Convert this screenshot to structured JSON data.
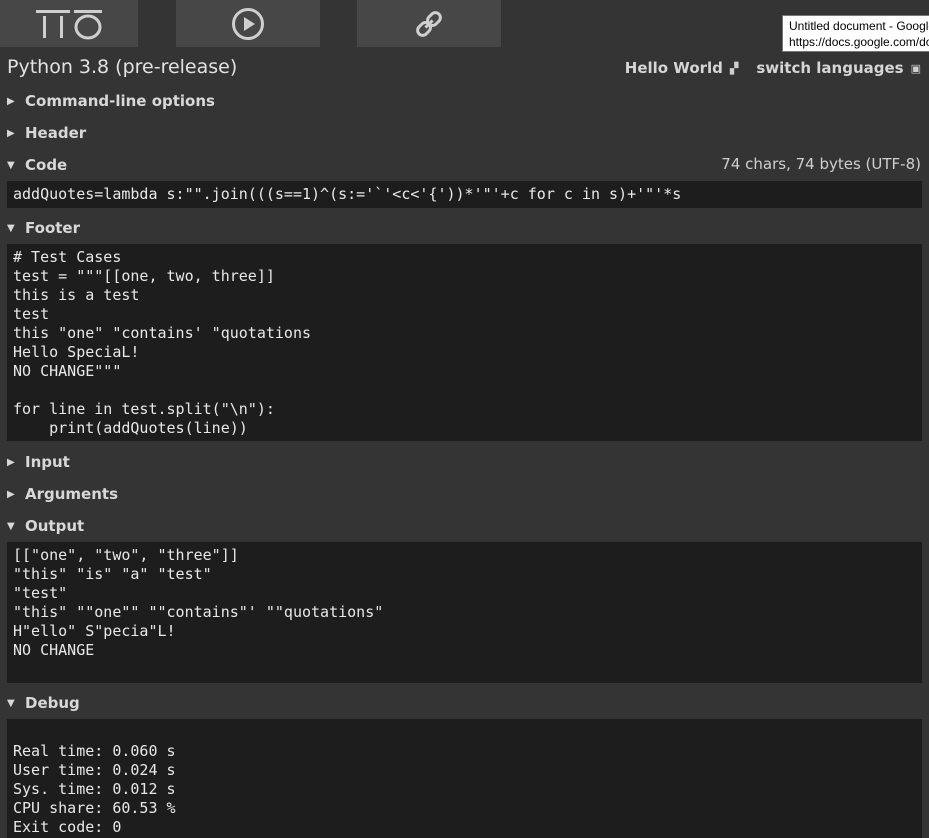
{
  "topbar": {
    "logo_text": "TIO",
    "run_label": "run",
    "link_label": "permalink"
  },
  "tooltip": {
    "title": "Untitled document - Google Docs",
    "url": "https://docs.google.com/document"
  },
  "language": {
    "title": "Python 3.8 (pre-release)",
    "hello_world": "Hello World",
    "switch": "switch languages"
  },
  "sections": {
    "cmdline": "Command-line options",
    "header": "Header",
    "code": "Code",
    "footer": "Footer",
    "input": "Input",
    "arguments": "Arguments",
    "output": "Output",
    "debug": "Debug"
  },
  "code": {
    "stats": "74 chars, 74 bytes (UTF-8)",
    "text": "addQuotes=lambda s:\"\".join(((s==1)^(s:='`'<c<'{'))*'\"'+c for c in s)+'\"'*s"
  },
  "footer": {
    "text": "# Test Cases\ntest = \"\"\"[[one, two, three]]\nthis is a test\ntest\nthis \"one\" \"contains' \"quotations\nHello SpeciaL!\nNO CHANGE\"\"\"\n\nfor line in test.split(\"\\n\"):\n    print(addQuotes(line))"
  },
  "output": {
    "text": "[[\"one\", \"two\", \"three\"]]\n\"this\" \"is\" \"a\" \"test\"\n\"test\"\n\"this\" \"\"one\"\" \"\"contains\"' \"\"quotations\"\nH\"ello\" S\"pecia\"L!\nNO CHANGE"
  },
  "debug": {
    "text": "\nReal time: 0.060 s\nUser time: 0.024 s\nSys. time: 0.012 s\nCPU share: 60.53 %\nExit code: 0"
  }
}
